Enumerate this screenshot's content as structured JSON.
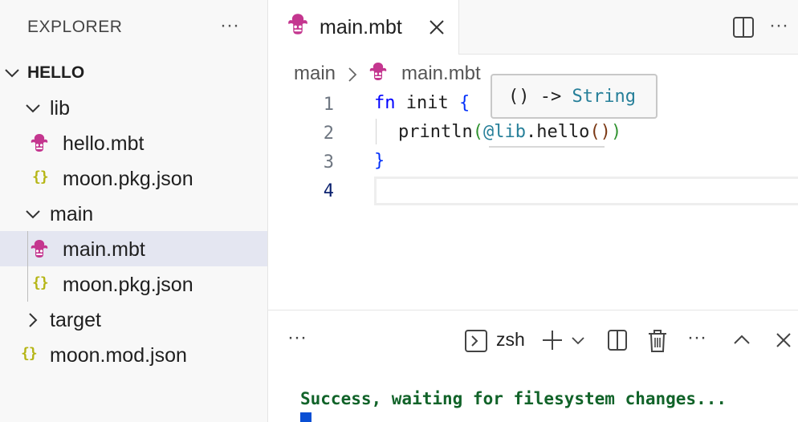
{
  "sidebar": {
    "title": "EXPLORER",
    "more": "···",
    "tree": {
      "root": "HELLO",
      "lib": "lib",
      "hello_mbt": "hello.mbt",
      "lib_pkg": "moon.pkg.json",
      "main": "main",
      "main_mbt": "main.mbt",
      "main_pkg": "moon.pkg.json",
      "target": "target",
      "mod_json": "moon.mod.json",
      "json_icon_glyph": "{}"
    }
  },
  "editor": {
    "tab_label": "main.mbt",
    "more": "···",
    "breadcrumb": {
      "folder": "main",
      "file": "main.mbt"
    },
    "line_numbers": [
      "1",
      "2",
      "3",
      "4"
    ],
    "code": {
      "l1_kw": "fn",
      "l1_name": " init ",
      "l1_brace": "{",
      "l2_call": "println",
      "l2_open": "(",
      "l2_pkg": "@lib",
      "l2_dot": ".",
      "l2_fn": "hello",
      "l2_inner": "()",
      "l2_close": ")",
      "l3_brace": "}"
    },
    "hover": {
      "sig": "() -> ",
      "type": "String"
    }
  },
  "panel": {
    "more": "···",
    "shell": "zsh",
    "terminal_output": "Success, waiting for filesystem changes..."
  },
  "colors": {
    "moonbit_icon": "#c4368f",
    "json_icon": "#b5b515",
    "selection": "#e4e6f1",
    "keyword": "#0000ff",
    "terminal_success": "#116329",
    "cursor": "#0a4fd4"
  }
}
